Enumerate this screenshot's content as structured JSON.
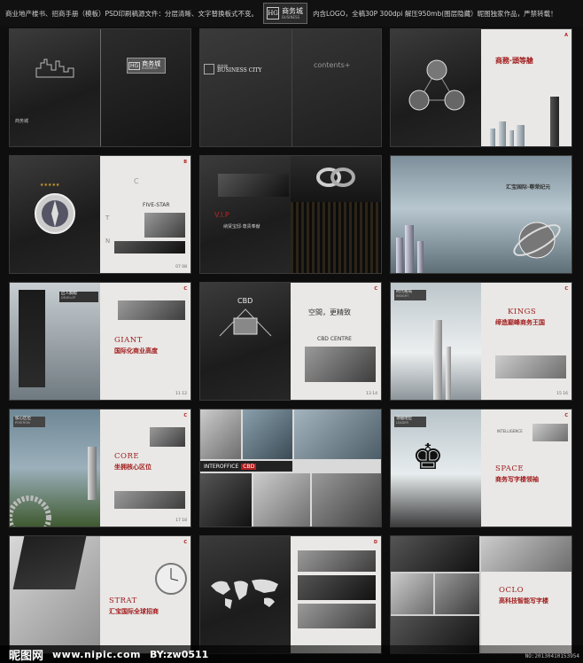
{
  "header": {
    "left_text": "商业地产楼书、招商手册（模板）PSD印刷稿源文件：分层清晰、文字替换板式不变。",
    "logo_mark": "HG",
    "logo_name": "商务城",
    "logo_en": "BUSINESS",
    "right_text": "内含LOGO，全稿30P 300dpi 解压950mb(图层隐藏）昵图独家作品，严禁转载！"
  },
  "spreads": [
    {
      "id": "s1",
      "cover_name": "商务城",
      "cover_en": "BUSINESS",
      "cover_mark": "HG",
      "back_text": "商务城"
    },
    {
      "id": "s2",
      "logo_cn": "商务城",
      "logo_en": "BUSINESS CITY",
      "contents": "contents+"
    },
    {
      "id": "s3",
      "title_cn": "商務·頭等艙",
      "tag": "A"
    },
    {
      "id": "s4",
      "five_star": "FIVE-STAR",
      "tag": "B",
      "c_letter": "C",
      "t_letter": "T",
      "n_letter": "N",
      "pages": "07 08"
    },
    {
      "id": "s5",
      "vip": "V.I.P",
      "title_cn": "纳贤宝邸·尊贵奉献"
    },
    {
      "id": "s6",
      "title_cn": "汇宝国际·尊荣纪元"
    },
    {
      "id": "s7",
      "left_label": "启人胸襟",
      "left_label_en": "DEVELOP",
      "heading_en": "GIANT",
      "heading_cn": "国际化商业高度",
      "tag": "C",
      "pages": "11 12"
    },
    {
      "id": "s8",
      "cbd": "CBD",
      "title_cn": "空間，更精致",
      "cbd_centre": "CBD CENTRE",
      "tag": "C",
      "pages": "13 14"
    },
    {
      "id": "s9",
      "left_label": "时代格局",
      "left_label_en": "INSIGHT",
      "heading_en": "KINGS",
      "heading_cn": "缔造巅峰商务王国",
      "tag": "C",
      "pages": "15 16"
    },
    {
      "id": "s10",
      "left_label": "核心区位",
      "left_label_en": "POSITION",
      "heading_en": "CORE",
      "heading_cn": "坐拥核心区位",
      "tag": "C",
      "pages": "17 18"
    },
    {
      "id": "s11",
      "interoffice": "INTEROFFICE",
      "cbd": "CBD"
    },
    {
      "id": "s12",
      "left_label": "领袖地位",
      "left_label_en": "LEADER",
      "intelligence": "INTELLIGENCE",
      "heading_en": "SPACE",
      "heading_cn": "商务写字楼领袖",
      "tag": "C"
    },
    {
      "id": "s13",
      "heading_en": "STRAT",
      "heading_cn": "汇宝国际全球招商",
      "tag": "C"
    },
    {
      "id": "s14",
      "tag": "D"
    },
    {
      "id": "s15",
      "heading_en": "OCLO",
      "heading_cn": "高科技智能写字楼"
    }
  ],
  "watermark": {
    "site_cn": "昵图网",
    "site_url": "www.nipic.com",
    "by": "BY:zw0511",
    "code": "NO:20130410153954"
  }
}
